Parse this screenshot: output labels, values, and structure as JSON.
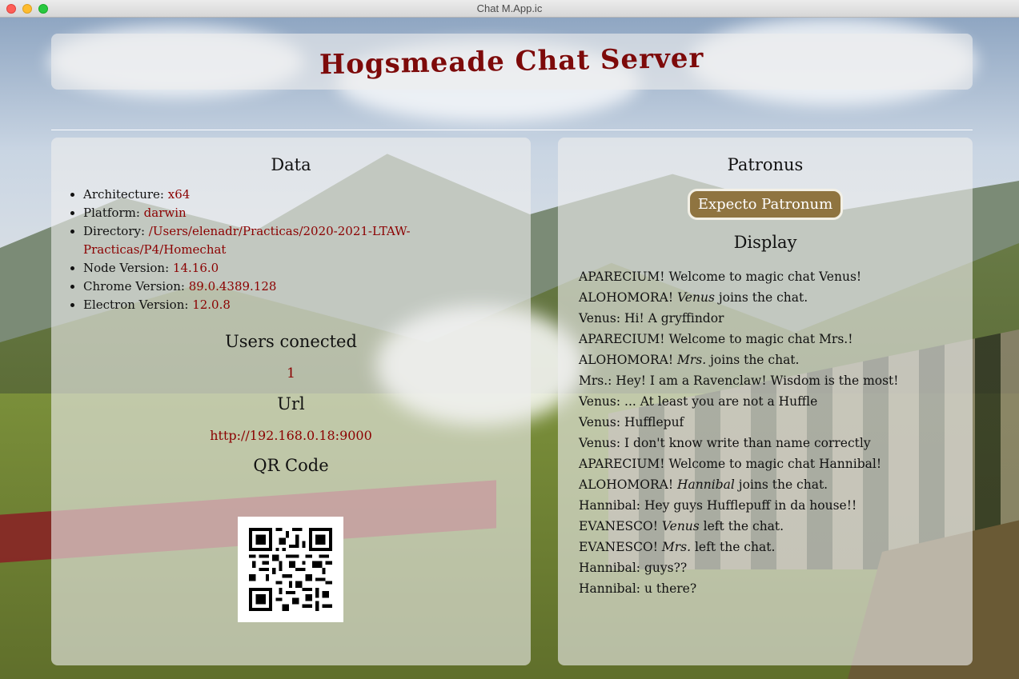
{
  "window": {
    "title": "Chat M.App.ic"
  },
  "header": {
    "title": "Hogsmeade Chat Server"
  },
  "data_section": {
    "title": "Data",
    "items": [
      {
        "label": "Architecture: ",
        "value": "x64"
      },
      {
        "label": "Platform: ",
        "value": "darwin"
      },
      {
        "label": "Directory: ",
        "value": "/Users/elenadr/Practicas/2020-2021-LTAW-Practicas/P4/Homechat"
      },
      {
        "label": "Node Version: ",
        "value": "14.16.0"
      },
      {
        "label": "Chrome Version: ",
        "value": "89.0.4389.128"
      },
      {
        "label": "Electron Version: ",
        "value": "12.0.8"
      }
    ],
    "users_title": "Users conected",
    "users_count": "1",
    "url_title": "Url",
    "url_value": "http://192.168.0.18:9000",
    "qr_title": "QR Code"
  },
  "chat_section": {
    "patronus_title": "Patronus",
    "patronus_button": "Expecto Patronum",
    "display_title": "Display",
    "messages": [
      {
        "pre": "APARECIUM! Welcome to magic chat Venus!",
        "name": "",
        "post": ""
      },
      {
        "pre": "ALOHOMORA! ",
        "name": "Venus",
        "post": " joins the chat."
      },
      {
        "pre": "Venus: Hi! A gryffindor",
        "name": "",
        "post": ""
      },
      {
        "pre": "APARECIUM! Welcome to magic chat Mrs.!",
        "name": "",
        "post": ""
      },
      {
        "pre": "ALOHOMORA! ",
        "name": "Mrs.",
        "post": " joins the chat."
      },
      {
        "pre": "Mrs.: Hey! I am a Ravenclaw! Wisdom is the most!",
        "name": "",
        "post": ""
      },
      {
        "pre": "Venus: ... At least you are not a Huffle",
        "name": "",
        "post": ""
      },
      {
        "pre": "Venus: Hufflepuf",
        "name": "",
        "post": ""
      },
      {
        "pre": "Venus: I don't know write than name correctly",
        "name": "",
        "post": ""
      },
      {
        "pre": "APARECIUM! Welcome to magic chat Hannibal!",
        "name": "",
        "post": ""
      },
      {
        "pre": "ALOHOMORA! ",
        "name": "Hannibal",
        "post": " joins the chat."
      },
      {
        "pre": "Hannibal: Hey guys Hufflepuff in da house!!",
        "name": "",
        "post": ""
      },
      {
        "pre": "EVANESCO! ",
        "name": "Venus",
        "post": " left the chat."
      },
      {
        "pre": "EVANESCO! ",
        "name": "Mrs.",
        "post": " left the chat."
      },
      {
        "pre": "Hannibal: guys??",
        "name": "",
        "post": ""
      },
      {
        "pre": "Hannibal: u there?",
        "name": "",
        "post": ""
      }
    ]
  },
  "colors": {
    "title_red": "#7d0a0a",
    "value_red": "#8b0000",
    "button_gold": "#8f7440"
  }
}
